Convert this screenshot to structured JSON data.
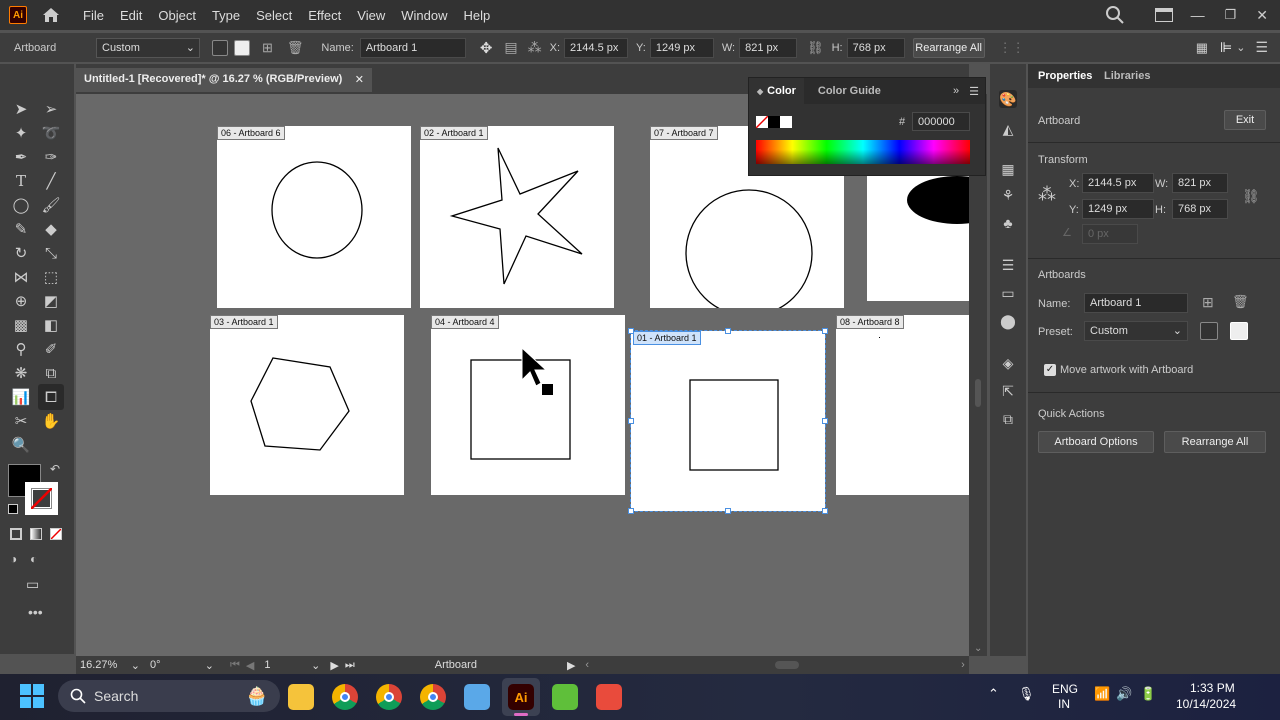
{
  "menu": {
    "items": [
      "File",
      "Edit",
      "Object",
      "Type",
      "Select",
      "Effect",
      "View",
      "Window",
      "Help"
    ]
  },
  "control": {
    "mode": "Artboard",
    "preset": "Custom",
    "name_label": "Name:",
    "name_value": "Artboard 1",
    "x_label": "X:",
    "x_value": "2144.5 px",
    "y_label": "Y:",
    "y_value": "1249 px",
    "w_label": "W:",
    "w_value": "821 px",
    "h_label": "H:",
    "h_value": "768 px",
    "rearrange": "Rearrange All"
  },
  "document": {
    "tab_title": "Untitled-1 [Recovered]* @ 16.27 % (RGB/Preview)",
    "close": "✕"
  },
  "artboards": [
    {
      "label": "06 - Artboard 6"
    },
    {
      "label": "02 - Artboard 1"
    },
    {
      "label": "07 - Artboard 7"
    },
    {
      "label": "03 - Artboard 1"
    },
    {
      "label": "04 - Artboard 4"
    },
    {
      "label": "01 - Artboard 1"
    },
    {
      "label": "08 - Artboard 8"
    }
  ],
  "color_panel": {
    "tab_color": "Color",
    "tab_guide": "Color Guide",
    "hash": "#",
    "hex": "000000"
  },
  "status": {
    "zoom": "16.27%",
    "rotation": "0°",
    "page": "1",
    "tool": "Artboard"
  },
  "properties": {
    "tab_properties": "Properties",
    "tab_libraries": "Libraries",
    "artboard": "Artboard",
    "exit": "Exit",
    "transform": "Transform",
    "x_label": "X:",
    "x_value": "2144.5 px",
    "y_label": "Y:",
    "y_value": "1249 px",
    "w_label": "W:",
    "w_value": "821 px",
    "h_label": "H:",
    "h_value": "768 px",
    "angle_value": "0 px",
    "artboards_section": "Artboards",
    "name_label": "Name:",
    "name_value": "Artboard 1",
    "preset_label": "Preset:",
    "preset_value": "Custom",
    "move_artwork": "Move artwork with Artboard",
    "quick_actions": "Quick Actions",
    "artboard_options": "Artboard Options",
    "rearrange_all": "Rearrange All"
  },
  "taskbar": {
    "search": "Search",
    "lang1": "ENG",
    "lang2": "IN",
    "time": "1:33 PM",
    "date": "10/14/2024"
  },
  "colors": {
    "accent": "#1473e6",
    "ai_orange": "#ff9a00",
    "selection": "#4a90e2"
  }
}
